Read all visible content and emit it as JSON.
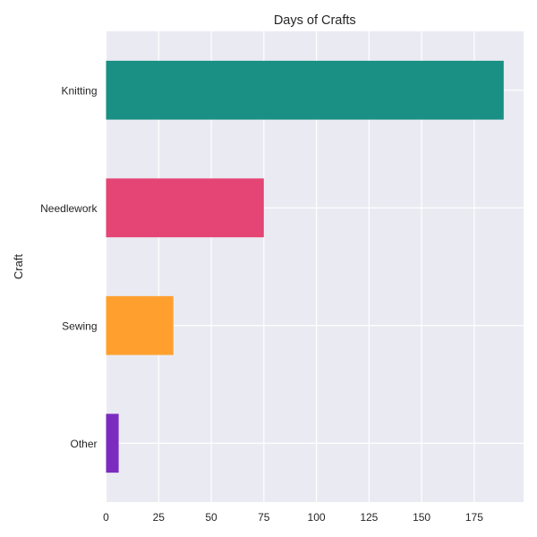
{
  "chart_data": {
    "type": "bar",
    "orientation": "horizontal",
    "title": "Days of Crafts",
    "xlabel": "",
    "ylabel": "Craft",
    "categories": [
      "Other",
      "Sewing",
      "Needlework",
      "Knitting"
    ],
    "values": [
      6,
      32,
      75,
      189
    ],
    "colors": [
      "#7b2cbf",
      "#ffa02e",
      "#e44574",
      "#1a8f83"
    ],
    "xlim": [
      0,
      198.45
    ],
    "xticks": [
      0,
      25,
      50,
      75,
      100,
      125,
      150,
      175
    ],
    "grid": true,
    "legend": "none",
    "style": {
      "plot_background": "#eaeaf2",
      "grid_color": "#ffffff",
      "text_color": "#262626"
    }
  }
}
